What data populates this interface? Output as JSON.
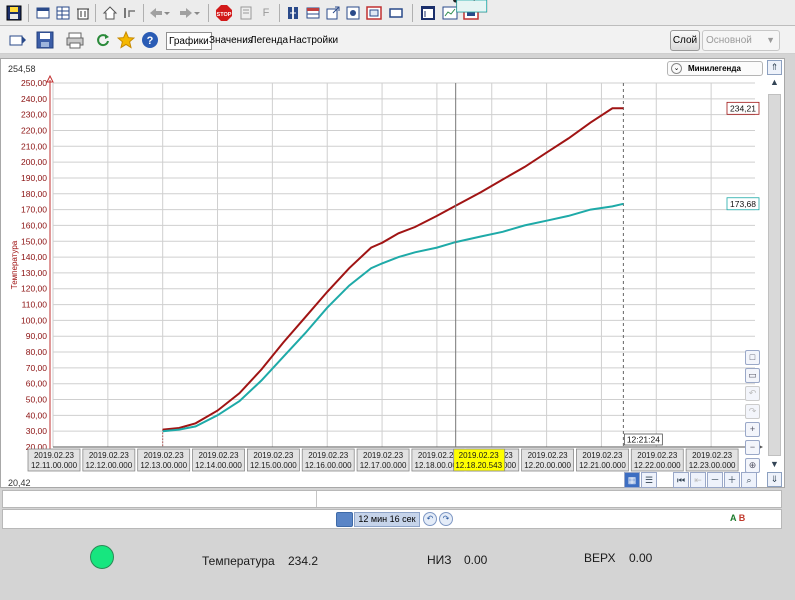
{
  "toolbar1": {
    "icons": [
      "save-disk-icon",
      "window-icon",
      "grid-icon",
      "trash-icon",
      "home-icon",
      "step-back-icon",
      "back-arrow-icon",
      "forward-arrow-icon",
      "stop-icon",
      "print-preview-icon",
      "f-icon",
      "link-icon",
      "table-icon",
      "export-icon",
      "frame-icon",
      "rectangle-icon",
      "chart-window-icon",
      "graph-icon",
      "image-icon"
    ],
    "stop_label": "STOP",
    "f_label": "F"
  },
  "toolbar2": {
    "tabs": [
      "Графики",
      "Значения",
      "Легенда",
      "Настройки"
    ],
    "active_tab": "Графики",
    "sloy_label": "Слой",
    "layer_select_value": "Основной"
  },
  "chart": {
    "y_top_readout": "254,58",
    "y_bottom_readout": "20,42",
    "minilegend_label": "Минилегенда",
    "cursor_time_label": "12:21:24",
    "accent_color": "#ffff00"
  },
  "chart_data": {
    "type": "line",
    "ylabel": "Температура",
    "ylim": [
      20,
      250
    ],
    "ytick_step": 10,
    "x_ticks": [
      [
        "2019.02.23",
        "12.11.00.000"
      ],
      [
        "2019.02.23",
        "12.12.00.000"
      ],
      [
        "2019.02.23",
        "12.13.00.000"
      ],
      [
        "2019.02.23",
        "12.14.00.000"
      ],
      [
        "2019.02.23",
        "12.15.00.000"
      ],
      [
        "2019.02.23",
        "12.16.00.000"
      ],
      [
        "2019.02.23",
        "12.17.00.000"
      ],
      [
        "2019.02.23",
        "12.18.00.000"
      ],
      [
        "2019.02.23",
        "12.19.00.000"
      ],
      [
        "2019.02.23",
        "12.20.00.000"
      ],
      [
        "2019.02.23",
        "12.21.00.000"
      ],
      [
        "2019.02.23",
        "12.22.00.000"
      ],
      [
        "2019.02.23",
        "12.23.00.000"
      ]
    ],
    "x_minutes_range": [
      11,
      23.8
    ],
    "cursor": {
      "x_minute": 18.3424,
      "label": [
        "2019.02.23",
        "12.18.20.543"
      ]
    },
    "end_x_minute": 21.4,
    "series": [
      {
        "color": "#a01414",
        "marker_value": "172,54",
        "last_value": "234,21",
        "x": [
          13.0,
          13.3,
          13.6,
          14.0,
          14.4,
          14.8,
          15.2,
          15.6,
          16.0,
          16.4,
          16.8,
          17.0,
          17.3,
          17.6,
          18.0,
          18.34,
          18.8,
          19.2,
          19.6,
          20.0,
          20.4,
          20.8,
          21.2,
          21.4
        ],
        "y": [
          31,
          32,
          35,
          43,
          54,
          69,
          86,
          102,
          118,
          133,
          146,
          149,
          155,
          159,
          166,
          172.5,
          181,
          189,
          197,
          206,
          215,
          225,
          234,
          234
        ]
      },
      {
        "color": "#1eaaa8",
        "marker_value": "149,48",
        "last_value": "173,68",
        "x": [
          13.0,
          13.3,
          13.6,
          14.0,
          14.4,
          14.8,
          15.2,
          15.6,
          16.0,
          16.4,
          16.8,
          17.0,
          17.3,
          17.6,
          18.0,
          18.34,
          18.8,
          19.2,
          19.6,
          20.0,
          20.4,
          20.8,
          21.2,
          21.4
        ],
        "y": [
          30,
          31,
          33,
          40,
          49,
          62,
          77,
          92,
          108,
          122,
          133,
          136,
          140,
          143,
          146,
          149.5,
          153,
          156,
          160,
          163,
          166,
          170,
          172,
          173.7
        ]
      }
    ]
  },
  "bottom": {
    "period_label": "12 мин 16 сек",
    "a_label": "A",
    "b_label": "B"
  },
  "status": {
    "led_color": "#17e67f",
    "temp_label": "Температура",
    "temp_value": "234.2",
    "low_label": "НИЗ",
    "low_value": "0.00",
    "high_label": "ВЕРХ",
    "high_value": "0.00"
  }
}
